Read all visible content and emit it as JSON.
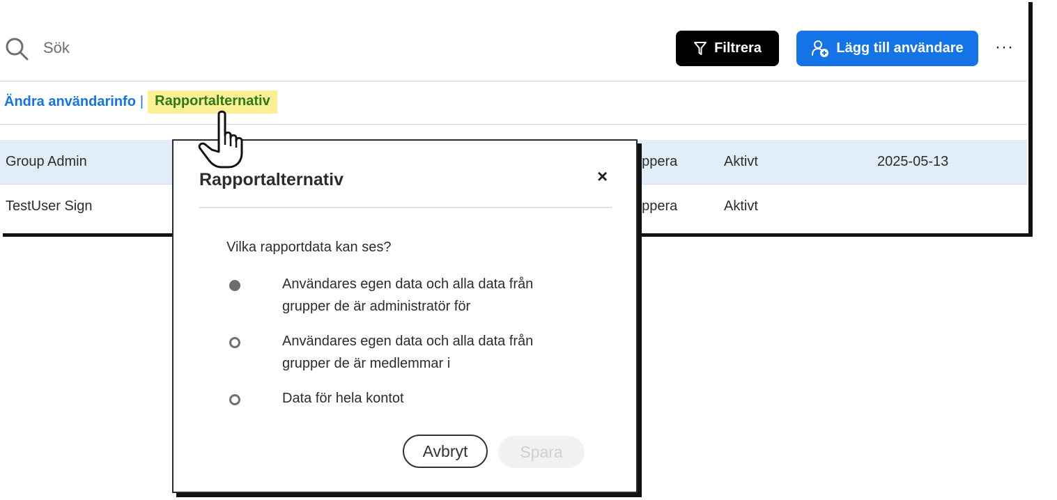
{
  "toolbar": {
    "search_placeholder": "Sök",
    "filter_label": "Filtrera",
    "add_user_label": "Lägg till användare",
    "more_label": "···"
  },
  "actions": {
    "edit_user_info": "Ändra användarinfo",
    "separator": "|",
    "report_options": "Rapportalternativ"
  },
  "table": {
    "rows": [
      {
        "name": "Group Admin",
        "group": "uppera",
        "status": "Aktivt",
        "date": "2025-05-13",
        "selected": true
      },
      {
        "name": "TestUser Sign",
        "group": "uppera",
        "status": "Aktivt",
        "date": "",
        "selected": false
      }
    ]
  },
  "dialog": {
    "title": "Rapportalternativ",
    "close_label": "×",
    "question": "Vilka rapportdata kan ses?",
    "options": [
      {
        "label": "Användares egen data och alla data från grupper de är administratör för",
        "checked": true
      },
      {
        "label": "Användares egen data och alla data från grupper de är medlemmar i",
        "checked": false
      },
      {
        "label": "Data för hela kontot",
        "checked": false
      }
    ],
    "cancel_label": "Avbryt",
    "save_label": "Spara",
    "save_enabled": false
  },
  "colors": {
    "primary_blue": "#1473e6",
    "highlight_yellow": "#fbf094",
    "highlight_text_green": "#2d7a17",
    "selected_row": "#e1eef9"
  },
  "icons": {
    "search": "search-icon",
    "filter": "filter-icon",
    "add_user": "add-user-icon",
    "cursor": "hand-pointer-cursor-icon"
  }
}
